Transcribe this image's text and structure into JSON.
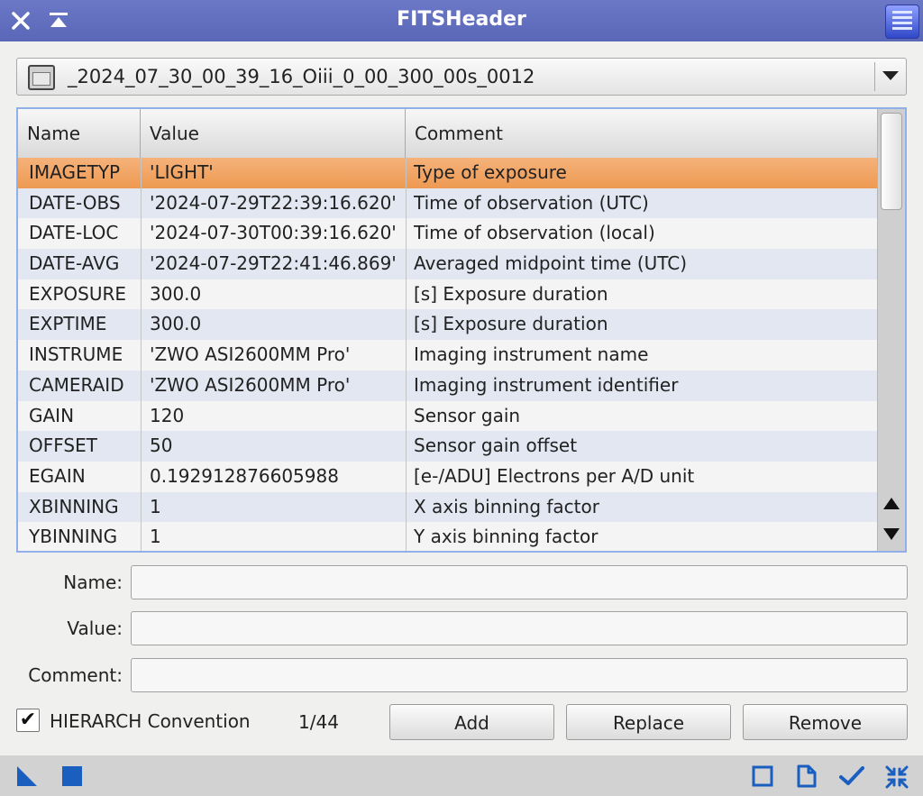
{
  "window": {
    "title": "FITSHeader",
    "close_glyph": "✕",
    "shade_glyph": "⏶"
  },
  "image_selector": {
    "selected": "_2024_07_30_00_39_16_Oiii_0_00_300_00s_0012",
    "icon": "image-window-icon"
  },
  "table": {
    "columns": [
      "Name",
      "Value",
      "Comment"
    ],
    "selected_row": 0,
    "rows": [
      {
        "name": "IMAGETYP",
        "value": "'LIGHT'",
        "comment": "Type of exposure"
      },
      {
        "name": "DATE-OBS",
        "value": "'2024-07-29T22:39:16.620'",
        "comment": "Time of observation (UTC)"
      },
      {
        "name": "DATE-LOC",
        "value": "'2024-07-30T00:39:16.620'",
        "comment": "Time of observation (local)"
      },
      {
        "name": "DATE-AVG",
        "value": "'2024-07-29T22:41:46.869'",
        "comment": "Averaged midpoint time (UTC)"
      },
      {
        "name": "EXPOSURE",
        "value": "300.0",
        "comment": "[s] Exposure duration"
      },
      {
        "name": "EXPTIME",
        "value": "300.0",
        "comment": "[s] Exposure duration"
      },
      {
        "name": "INSTRUME",
        "value": "'ZWO ASI2600MM Pro'",
        "comment": "Imaging instrument name"
      },
      {
        "name": "CAMERAID",
        "value": "'ZWO ASI2600MM Pro'",
        "comment": "Imaging instrument identifier"
      },
      {
        "name": "GAIN",
        "value": "120",
        "comment": "Sensor gain"
      },
      {
        "name": "OFFSET",
        "value": "50",
        "comment": "Sensor gain offset"
      },
      {
        "name": "EGAIN",
        "value": "0.192912876605988",
        "comment": "[e-/ADU] Electrons per A/D unit"
      },
      {
        "name": "XBINNING",
        "value": "1",
        "comment": "X axis binning factor"
      },
      {
        "name": "YBINNING",
        "value": "1",
        "comment": "Y axis binning factor"
      }
    ]
  },
  "form": {
    "name_label": "Name:",
    "value_label": "Value:",
    "comment_label": "Comment:",
    "name_value": "",
    "value_value": "",
    "comment_value": ""
  },
  "options": {
    "hierarch_label": "HIERARCH Convention",
    "hierarch_checked": true,
    "counter": "1/44"
  },
  "buttons": {
    "add": "Add",
    "replace": "Replace",
    "remove": "Remove"
  },
  "colors": {
    "title_bar": "#5f6cbf",
    "selection": "#f0a060",
    "accent_blue": "#1a5fc0"
  },
  "footer_icons": [
    "new-instance-icon",
    "apply-global-icon",
    "reset-icon",
    "documentation-icon",
    "apply-icon",
    "collapse-icon"
  ]
}
